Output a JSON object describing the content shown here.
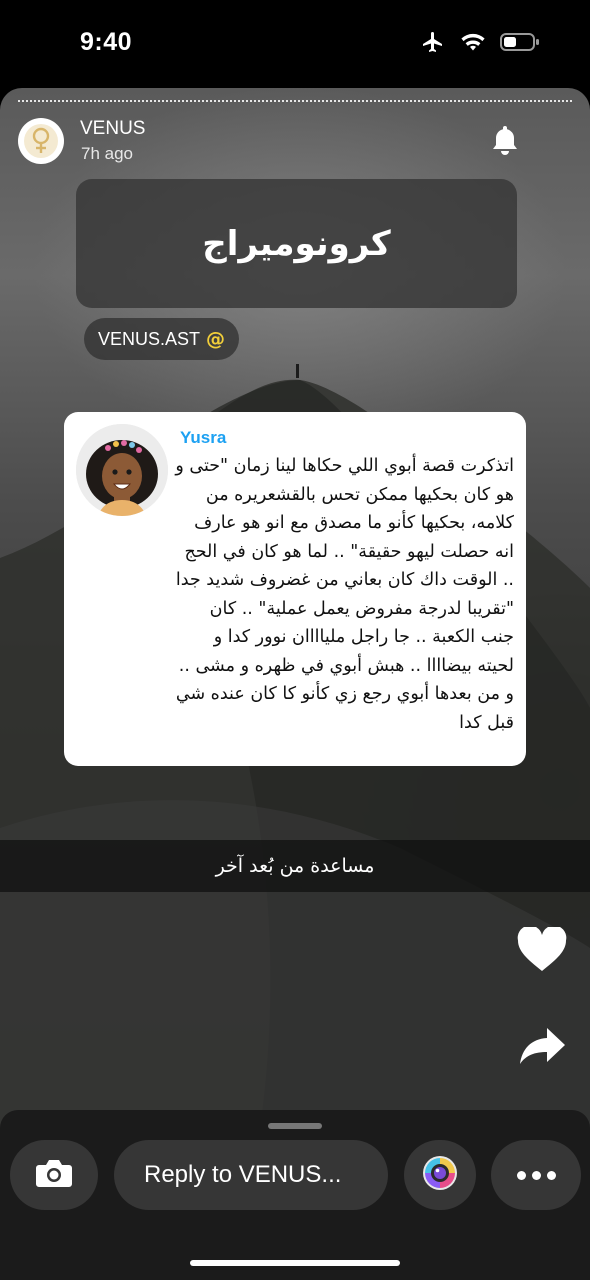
{
  "status_bar": {
    "time": "9:40",
    "icons": [
      "airplane-icon",
      "wifi-icon",
      "battery-icon"
    ]
  },
  "story": {
    "sender": {
      "name": "VENUS",
      "time_ago": "7h ago",
      "avatar_icon": "venus-symbol-icon"
    },
    "notification_icon": "bell-icon",
    "title": "كرونوميراج",
    "mention": {
      "text": "VENUS.AST",
      "symbol": "@"
    },
    "quote": {
      "author": "Yusra",
      "text": "اتذكرت قصة أبوي اللي حكاها لينا زمان \"حتى و هو كان بحكيها ممكن تحس بالقشعريره من كلامه، بحكيها كأنو ما مصدق مع انو هو عارف انه حصلت ليهو حقيقة\" .. لما هو كان في الحج .. الوقت داك كان بعاني من غضروف شديد جدا \"تقريبا لدرجة مفروض يعمل عملية\" .. كان جنب الكعبة .. جا راجل ملياااان نوور كدا و لحيته بيضاااا .. هبش أبوي في ظهره و مشى .. و من بعدها أبوي رجع زي كأنو كا كان عنده شي قبل كدا"
    },
    "caption": "مساعدة من بُعد آخر",
    "actions": {
      "like_icon": "heart-icon",
      "share_icon": "share-arrow-icon"
    }
  },
  "bottom_bar": {
    "camera_icon": "camera-icon",
    "reply_placeholder": "Reply to VENUS...",
    "lens_icon": "lens-icon",
    "more_icon": "more-dots-icon"
  },
  "colors": {
    "mention_at": "#f2cf3a",
    "quote_author": "#1da1f2",
    "bottom_bar_bg": "#1b1b1b",
    "button_bg": "#363636"
  }
}
